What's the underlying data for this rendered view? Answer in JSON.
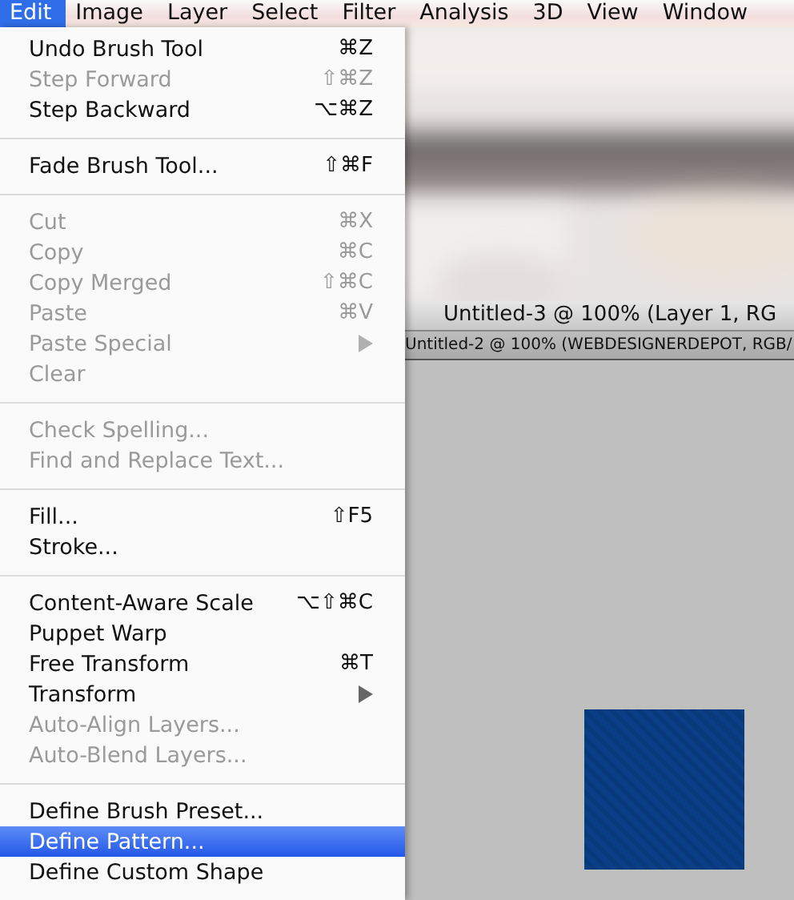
{
  "menu_bar": [
    {
      "label": "Edit",
      "selected": true
    },
    {
      "label": "Image",
      "selected": false
    },
    {
      "label": "Layer",
      "selected": false
    },
    {
      "label": "Select",
      "selected": false
    },
    {
      "label": "Filter",
      "selected": false
    },
    {
      "label": "Analysis",
      "selected": false
    },
    {
      "label": "3D",
      "selected": false
    },
    {
      "label": "View",
      "selected": false
    },
    {
      "label": "Window",
      "selected": false
    }
  ],
  "edit_menu": [
    {
      "kind": "item",
      "label": "Undo Brush Tool",
      "shortcut": "⌘Z",
      "disabled": false,
      "selected": false,
      "submenu": false
    },
    {
      "kind": "item",
      "label": "Step Forward",
      "shortcut": "⇧⌘Z",
      "disabled": true,
      "selected": false,
      "submenu": false
    },
    {
      "kind": "item",
      "label": "Step Backward",
      "shortcut": "⌥⌘Z",
      "disabled": false,
      "selected": false,
      "submenu": false
    },
    {
      "kind": "separator"
    },
    {
      "kind": "item",
      "label": "Fade Brush Tool...",
      "shortcut": "⇧⌘F",
      "disabled": false,
      "selected": false,
      "submenu": false
    },
    {
      "kind": "separator"
    },
    {
      "kind": "item",
      "label": "Cut",
      "shortcut": "⌘X",
      "disabled": true,
      "selected": false,
      "submenu": false
    },
    {
      "kind": "item",
      "label": "Copy",
      "shortcut": "⌘C",
      "disabled": true,
      "selected": false,
      "submenu": false
    },
    {
      "kind": "item",
      "label": "Copy Merged",
      "shortcut": "⇧⌘C",
      "disabled": true,
      "selected": false,
      "submenu": false
    },
    {
      "kind": "item",
      "label": "Paste",
      "shortcut": "⌘V",
      "disabled": true,
      "selected": false,
      "submenu": false
    },
    {
      "kind": "item",
      "label": "Paste Special",
      "disabled": true,
      "selected": false,
      "submenu": true
    },
    {
      "kind": "item",
      "label": "Clear",
      "disabled": true,
      "selected": false,
      "submenu": false
    },
    {
      "kind": "separator"
    },
    {
      "kind": "item",
      "label": "Check Spelling...",
      "disabled": true,
      "selected": false,
      "submenu": false
    },
    {
      "kind": "item",
      "label": "Find and Replace Text...",
      "disabled": true,
      "selected": false,
      "submenu": false
    },
    {
      "kind": "separator"
    },
    {
      "kind": "item",
      "label": "Fill...",
      "shortcut": "⇧F5",
      "disabled": false,
      "selected": false,
      "submenu": false
    },
    {
      "kind": "item",
      "label": "Stroke...",
      "disabled": false,
      "selected": false,
      "submenu": false
    },
    {
      "kind": "separator"
    },
    {
      "kind": "item",
      "label": "Content-Aware Scale",
      "shortcut": "⌥⇧⌘C",
      "disabled": false,
      "selected": false,
      "submenu": false
    },
    {
      "kind": "item",
      "label": "Puppet Warp",
      "disabled": false,
      "selected": false,
      "submenu": false
    },
    {
      "kind": "item",
      "label": "Free Transform",
      "shortcut": "⌘T",
      "disabled": false,
      "selected": false,
      "submenu": false
    },
    {
      "kind": "item",
      "label": "Transform",
      "disabled": false,
      "selected": false,
      "submenu": true
    },
    {
      "kind": "item",
      "label": "Auto-Align Layers...",
      "disabled": true,
      "selected": false,
      "submenu": false
    },
    {
      "kind": "item",
      "label": "Auto-Blend Layers...",
      "disabled": true,
      "selected": false,
      "submenu": false
    },
    {
      "kind": "separator"
    },
    {
      "kind": "item",
      "label": "Define Brush Preset...",
      "disabled": false,
      "selected": false,
      "submenu": false
    },
    {
      "kind": "item",
      "label": "Define Pattern...",
      "disabled": false,
      "selected": true,
      "submenu": false
    },
    {
      "kind": "item",
      "label": "Define Custom Shape",
      "disabled": false,
      "selected": false,
      "submenu": false
    }
  ],
  "document_window": {
    "title": "Untitled-3 @ 100% (Layer 1, RG"
  },
  "document_tab": {
    "title": "Untitled-2 @ 100% (WEBDESIGNERDEPOT, RGB/"
  }
}
